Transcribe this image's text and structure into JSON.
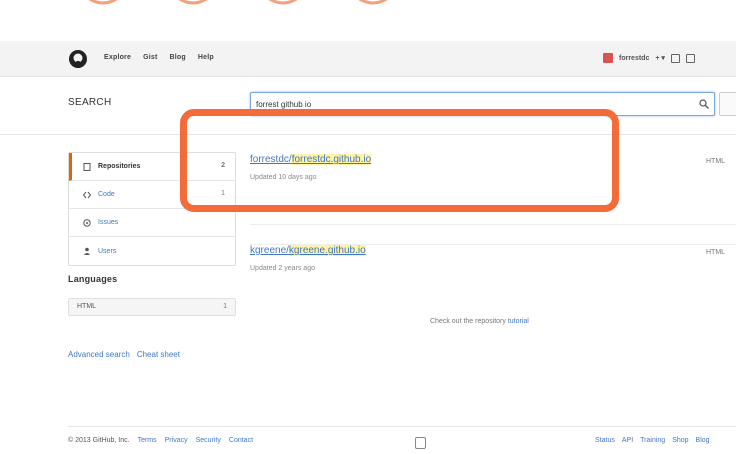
{
  "header": {
    "nav": [
      "Explore",
      "Gist",
      "Blog",
      "Help"
    ],
    "username": "forrestdc",
    "plus": "+ ▾"
  },
  "search": {
    "title": "SEARCH",
    "query": "forrest github io"
  },
  "sidebar": {
    "items": [
      {
        "label": "Repositories",
        "count": "2"
      },
      {
        "label": "Code",
        "count": "1"
      },
      {
        "label": "Issues",
        "count": ""
      },
      {
        "label": "Users",
        "count": ""
      }
    ],
    "languages_title": "Languages",
    "language": {
      "name": "HTML",
      "count": "1"
    },
    "links": [
      "Advanced search",
      "Cheat sheet"
    ]
  },
  "results": [
    {
      "owner": "forrestdc/",
      "name": "forrestdc.github.io",
      "meta": "Updated 10 days ago",
      "side": "HTML"
    },
    {
      "owner": "kgreene/",
      "name": "kgreene.github.io",
      "meta": "Updated 2 years ago",
      "side": "HTML"
    }
  ],
  "note": {
    "text": "Check out the repository",
    "link": "tutorial"
  },
  "footer": {
    "copyright": "© 2013 GitHub, Inc.",
    "left_links": [
      "Terms",
      "Privacy",
      "Security",
      "Contact"
    ],
    "right_links": [
      "Status",
      "API",
      "Training",
      "Shop",
      "Blog"
    ]
  },
  "colors": {
    "highlight": "#f26b38",
    "link": "#4078c0",
    "active_tab": "#d26911",
    "match_highlight": "#fff3a8"
  }
}
